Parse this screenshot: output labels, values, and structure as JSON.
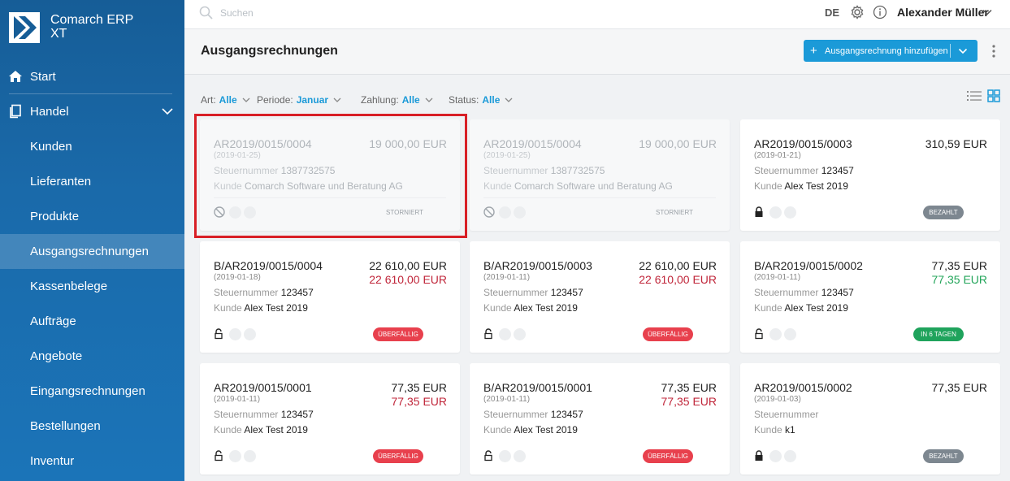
{
  "app": {
    "title_line1": "Comarch ERP",
    "title_line2": "XT"
  },
  "sidebar": {
    "items": [
      {
        "label": "Start",
        "icon": "home-icon"
      },
      {
        "label": "Handel",
        "icon": "documents-icon"
      },
      {
        "label": "Kunden"
      },
      {
        "label": "Lieferanten"
      },
      {
        "label": "Produkte"
      },
      {
        "label": "Ausgangsrechnungen",
        "active": true
      },
      {
        "label": "Kassenbelege"
      },
      {
        "label": "Aufträge"
      },
      {
        "label": "Angebote"
      },
      {
        "label": "Eingangsrechnungen"
      },
      {
        "label": "Bestellungen"
      },
      {
        "label": "Inventur"
      }
    ]
  },
  "topbar": {
    "search_placeholder": "Suchen",
    "language": "DE",
    "user": "Alexander Müller"
  },
  "page": {
    "title": "Ausgangsrechnungen",
    "add_button": "Ausgangsrechnung hinzufügen"
  },
  "filters": [
    {
      "label": "Art:",
      "value": "Alle"
    },
    {
      "label": "Periode:",
      "value": "Januar"
    },
    {
      "label": "Zahlung:",
      "value": "Alle"
    },
    {
      "label": "Status:",
      "value": "Alle"
    }
  ],
  "labels": {
    "steuernummer": "Steuernummer",
    "kunde": "Kunde"
  },
  "cards": [
    {
      "number": "AR2019/0015/0004",
      "date": "(2019-01-25)",
      "amount": "19 000,00 EUR",
      "amount2": "",
      "tax": "1387732575",
      "customer": "Comarch Software und Beratung AG",
      "status": "STORNIERT",
      "muted": true
    },
    {
      "number": "AR2019/0015/0004",
      "date": "(2019-01-25)",
      "amount": "19 000,00 EUR",
      "amount2": "",
      "tax": "1387732575",
      "customer": "Comarch Software und Beratung AG",
      "status": "STORNIERT",
      "muted": true
    },
    {
      "number": "AR2019/0015/0003",
      "date": "(2019-01-21)",
      "amount": "310,59 EUR",
      "amount2": "",
      "tax": "123457",
      "customer": "Alex Test 2019",
      "status": "BEZAHLT"
    },
    {
      "number": "B/AR2019/0015/0004",
      "date": "(2019-01-18)",
      "amount": "22 610,00 EUR",
      "amount2": "22 610,00 EUR",
      "tax": "123457",
      "customer": "Alex Test 2019",
      "status": "ÜBERFÄLLIG"
    },
    {
      "number": "B/AR2019/0015/0003",
      "date": "(2019-01-11)",
      "amount": "22 610,00 EUR",
      "amount2": "22 610,00 EUR",
      "tax": "123457",
      "customer": "Alex Test 2019",
      "status": "ÜBERFÄLLIG"
    },
    {
      "number": "B/AR2019/0015/0002",
      "date": "(2019-01-11)",
      "amount": "77,35 EUR",
      "amount2": "77,35 EUR",
      "tax": "123457",
      "customer": "Alex Test 2019",
      "status": "IN 6 TAGEN"
    },
    {
      "number": "AR2019/0015/0001",
      "date": "(2019-01-11)",
      "amount": "77,35 EUR",
      "amount2": "77,35 EUR",
      "tax": "123457",
      "customer": "Alex Test 2019",
      "status": "ÜBERFÄLLIG"
    },
    {
      "number": "B/AR2019/0015/0001",
      "date": "(2019-01-11)",
      "amount": "77,35 EUR",
      "amount2": "77,35 EUR",
      "tax": "123457",
      "customer": "Alex Test 2019",
      "status": "ÜBERFÄLLIG"
    },
    {
      "number": "AR2019/0015/0002",
      "date": "(2019-01-03)",
      "amount": "77,35 EUR",
      "amount2": "",
      "tax": "",
      "customer": "k1",
      "status": "BEZAHLT"
    }
  ],
  "colors": {
    "accent": "#1b9ad8",
    "overdue": "#e8404d",
    "paid": "#7d8790",
    "soon": "#1fa35c",
    "highlight": "#d81f26"
  }
}
